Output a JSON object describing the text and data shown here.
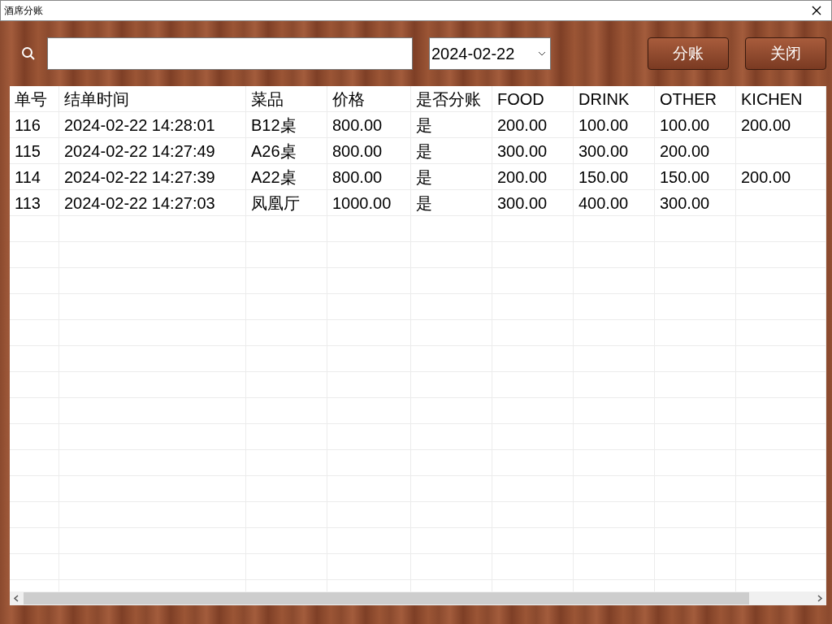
{
  "window": {
    "title": "酒席分账"
  },
  "toolbar": {
    "date": {
      "value": "2024-02-22"
    },
    "buttons": [
      "分账",
      "关闭"
    ]
  },
  "table": {
    "columns": [
      "单号",
      "结单时间",
      "菜品",
      "价格",
      "是否分账",
      "FOOD",
      "DRINK",
      "OTHER",
      "KICHEN"
    ],
    "rows": [
      [
        "116",
        "2024-02-22 14:28:01",
        "B12桌",
        "800.00",
        "是",
        "200.00",
        "100.00",
        "100.00",
        "200.00"
      ],
      [
        "115",
        "2024-02-22 14:27:49",
        "A26桌",
        "800.00",
        "是",
        "300.00",
        "300.00",
        "200.00",
        ""
      ],
      [
        "114",
        "2024-02-22 14:27:39",
        "A22桌",
        "800.00",
        "是",
        "200.00",
        "150.00",
        "150.00",
        "200.00"
      ],
      [
        "113",
        "2024-02-22 14:27:03",
        "凤凰厅",
        "1000.00",
        "是",
        "300.00",
        "400.00",
        "300.00",
        ""
      ]
    ]
  }
}
